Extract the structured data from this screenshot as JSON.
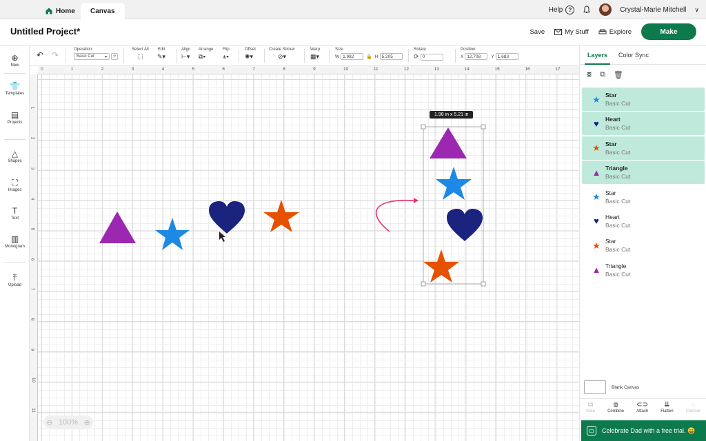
{
  "tabs": {
    "home": "Home",
    "canvas": "Canvas"
  },
  "topbar": {
    "help": "Help",
    "help_glyph": "?",
    "user": "Crystal-Marie Mitchell"
  },
  "header": {
    "project_title": "Untitled Project*",
    "save": "Save",
    "my_stuff": "My Stuff",
    "explore": "Explore",
    "make": "Make"
  },
  "toolbar": {
    "operation_label": "Operation",
    "operation_value": "Basic Cut",
    "select_all": "Select All",
    "edit": "Edit",
    "align": "Align",
    "arrange": "Arrange",
    "flip": "Flip",
    "offset": "Offset",
    "create_sticker": "Create Sticker",
    "warp": "Warp",
    "size": "Size",
    "w_label": "W",
    "w_value": "1.982",
    "h_label": "H",
    "h_value": "5.205",
    "rotate": "Rotate",
    "rotate_value": "0",
    "position": "Position",
    "x_label": "X",
    "x_value": "12.708",
    "y_label": "Y",
    "y_value": "1.683"
  },
  "rail": [
    {
      "label": "New",
      "icon": "plus-circle-icon",
      "glyph": "⊕"
    },
    {
      "label": "Templates",
      "icon": "shirt-icon",
      "glyph": "👕"
    },
    {
      "label": "Projects",
      "icon": "projects-icon",
      "glyph": "▤"
    },
    {
      "label": "Shapes",
      "icon": "shapes-icon",
      "glyph": "△"
    },
    {
      "label": "Images",
      "icon": "images-icon",
      "glyph": "⛶"
    },
    {
      "label": "Text",
      "icon": "text-icon",
      "glyph": "T"
    },
    {
      "label": "Monogram",
      "icon": "monogram-icon",
      "glyph": "▥"
    },
    {
      "label": "Upload",
      "icon": "upload-icon",
      "glyph": "⤒"
    }
  ],
  "rulers": {
    "top": [
      "0",
      "1",
      "2",
      "3",
      "4",
      "5",
      "6",
      "7",
      "8",
      "9",
      "10",
      "11",
      "12",
      "13",
      "14",
      "15",
      "16",
      "17"
    ],
    "left": [
      "1",
      "2",
      "3",
      "4",
      "5",
      "6",
      "7",
      "8",
      "9",
      "10",
      "11"
    ]
  },
  "canvas": {
    "size_tooltip": "1.98  in x 5.21  in",
    "zoom": "100%"
  },
  "colors": {
    "purple": "#9c27b0",
    "blue": "#1e88e5",
    "navy": "#1a237e",
    "orange": "#e65100",
    "accent": "#0d7a4d",
    "arrow": "#e8336d"
  },
  "panel": {
    "tab_layers": "Layers",
    "tab_color_sync": "Color Sync",
    "layers": [
      {
        "name": "Star",
        "op": "Basic Cut",
        "icon": "star-icon",
        "glyph": "★",
        "color": "#1e88e5",
        "selected": true
      },
      {
        "name": "Heart",
        "op": "Basic Cut",
        "icon": "heart-icon",
        "glyph": "♥",
        "color": "#1a237e",
        "selected": true
      },
      {
        "name": "Star",
        "op": "Basic Cut",
        "icon": "star-icon",
        "glyph": "★",
        "color": "#e65100",
        "selected": true
      },
      {
        "name": "Triangle",
        "op": "Basic Cut",
        "icon": "triangle-icon",
        "glyph": "▲",
        "color": "#9c27b0",
        "selected": true
      },
      {
        "name": "Star",
        "op": "Basic Cut",
        "icon": "star-icon",
        "glyph": "★",
        "color": "#1e88e5",
        "selected": false
      },
      {
        "name": "Heart",
        "op": "Basic Cut",
        "icon": "heart-icon",
        "glyph": "♥",
        "color": "#1a237e",
        "selected": false
      },
      {
        "name": "Star",
        "op": "Basic Cut",
        "icon": "star-icon",
        "glyph": "★",
        "color": "#e65100",
        "selected": false
      },
      {
        "name": "Triangle",
        "op": "Basic Cut",
        "icon": "triangle-icon",
        "glyph": "▲",
        "color": "#9c27b0",
        "selected": false
      }
    ],
    "blank_canvas": "Blank Canvas",
    "bottom": [
      {
        "label": "Slice",
        "icon": "slice-icon",
        "glyph": "⧉",
        "disabled": true
      },
      {
        "label": "Combine",
        "icon": "combine-icon",
        "glyph": "⧈",
        "disabled": false
      },
      {
        "label": "Attach",
        "icon": "attach-icon",
        "glyph": "⊂⊃",
        "disabled": false
      },
      {
        "label": "Flatten",
        "icon": "flatten-icon",
        "glyph": "⇊",
        "disabled": false
      },
      {
        "label": "Contour",
        "icon": "contour-icon",
        "glyph": "◌",
        "disabled": true
      }
    ]
  },
  "banner": {
    "text": "Celebrate Dad with a free trial. 😀"
  }
}
